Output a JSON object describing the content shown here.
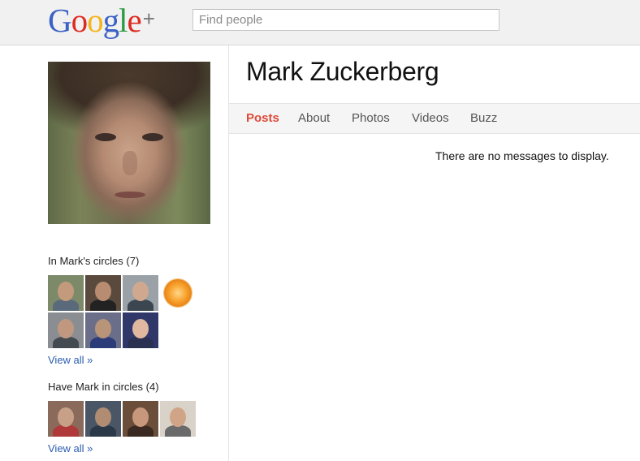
{
  "header": {
    "logo_letters": [
      {
        "ch": "G",
        "color": "#3b62c4"
      },
      {
        "ch": "o",
        "color": "#dd2b22"
      },
      {
        "ch": "o",
        "color": "#f2b51c"
      },
      {
        "ch": "g",
        "color": "#3b62c4"
      },
      {
        "ch": "l",
        "color": "#2e9a43"
      },
      {
        "ch": "e",
        "color": "#dd2b22"
      }
    ],
    "logo_plus": "+",
    "search_placeholder": "Find people"
  },
  "profile": {
    "name": "Mark Zuckerberg"
  },
  "tabs": [
    {
      "label": "Posts",
      "active": true
    },
    {
      "label": "About",
      "active": false
    },
    {
      "label": "Photos",
      "active": false
    },
    {
      "label": "Videos",
      "active": false
    },
    {
      "label": "Buzz",
      "active": false
    }
  ],
  "stream": {
    "empty_message": "There are no messages to display."
  },
  "in_circles": {
    "title": "In Mark's circles (7)",
    "view_all": "View all »",
    "avatars": [
      {
        "bg": "#7c8a6a",
        "skin": "#c49a7c",
        "shirt": "#5a6a7a"
      },
      {
        "bg": "#5a4a3e",
        "skin": "#b88c70",
        "shirt": "#222222"
      },
      {
        "bg": "#9aa2a8",
        "skin": "#d0a890",
        "shirt": "#3c4650"
      },
      {
        "bg": "#ffffff",
        "skin": "#f7a12a",
        "shirt": "#ffffff",
        "icon": "orange"
      },
      {
        "bg": "#8a8e92",
        "skin": "#c09880",
        "shirt": "#444a52"
      },
      {
        "bg": "#6a6e88",
        "skin": "#b89478",
        "shirt": "#2c3c78"
      },
      {
        "bg": "#30386a",
        "skin": "#e0b8a0",
        "shirt": "#2a3050"
      }
    ]
  },
  "have_in_circles": {
    "title": "Have Mark in circles (4)",
    "view_all": "View all »",
    "avatars": [
      {
        "bg": "#8a6a5a",
        "skin": "#c8a088",
        "shirt": "#b03a3a"
      },
      {
        "bg": "#4a5666",
        "skin": "#b08c72",
        "shirt": "#2a3848"
      },
      {
        "bg": "#6a4e3a",
        "skin": "#c8987c",
        "shirt": "#3a2a22"
      },
      {
        "bg": "#d8d2c8",
        "skin": "#d0a486",
        "shirt": "#6a6a6a"
      }
    ]
  }
}
